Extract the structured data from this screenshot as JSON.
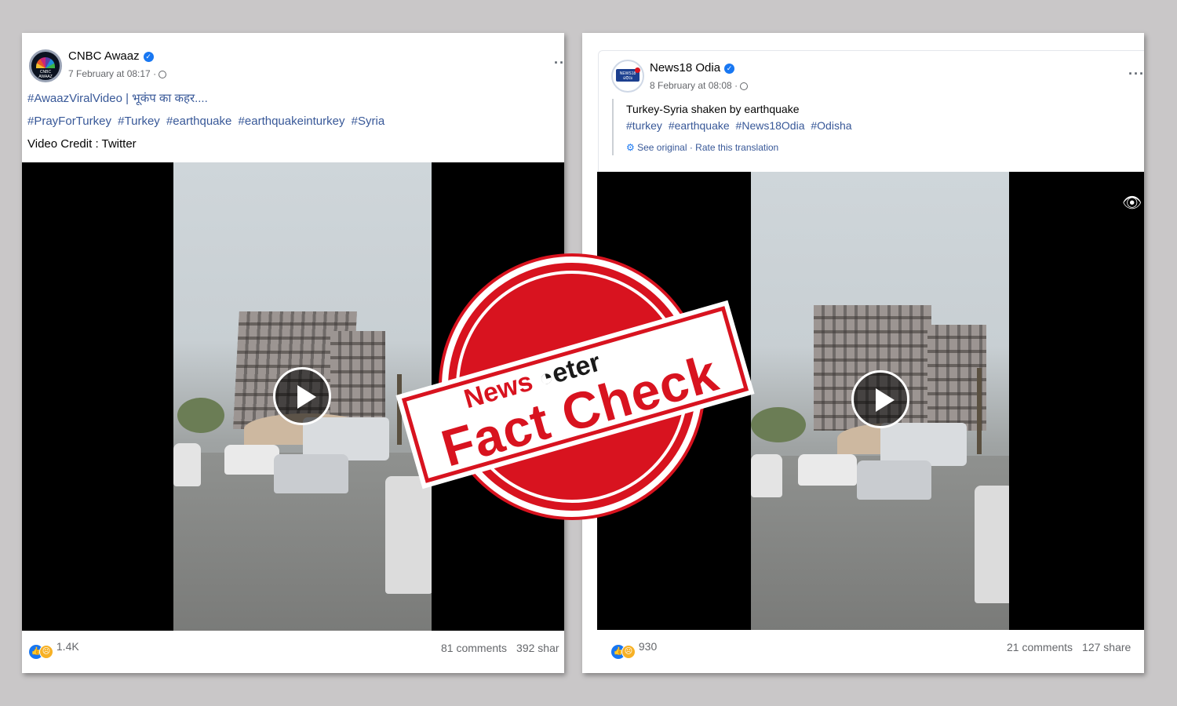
{
  "post_left": {
    "page_name": "CNBC Awaaz",
    "avatar_text": "CNBC AWAAZ",
    "timestamp": "7 February at 08:17 ·",
    "line1": "#AwaazViralVideo | भूकंप का कहर....",
    "hashtags": [
      "#PrayForTurkey",
      "#Turkey",
      "#earthquake",
      "#earthquakeinturkey",
      "#Syria"
    ],
    "credit": "Video Credit : Twitter",
    "more": "···",
    "reactions": "1.4K",
    "comments": "81 comments",
    "shares": "392 shar"
  },
  "post_right": {
    "page_name": "News18 Odia",
    "avatar_text": "NEWS18 ଓଡ଼ିଆ",
    "timestamp": "8 February at 08:08 ·",
    "caption": "Turkey-Syria shaken by earthquake",
    "hashtags": [
      "#turkey",
      "#earthquake",
      "#News18Odia",
      "#Odisha"
    ],
    "see_original": "See original",
    "rate_translation": "Rate this translation",
    "more": "···",
    "reactions": "930",
    "comments": "21 comments",
    "shares": "127 share"
  },
  "stamp": {
    "brand_part1": "News",
    "brand_part2": "eter",
    "headline": "Fact Check"
  },
  "colors": {
    "stamp_red": "#d8131f",
    "link_blue": "#385898",
    "like_blue": "#1877f2"
  },
  "icons": [
    "verified-badge-icon",
    "globe-icon",
    "play-icon",
    "like-reaction-icon",
    "sad-reaction-icon",
    "settings-gear-icon",
    "eye-icon"
  ]
}
